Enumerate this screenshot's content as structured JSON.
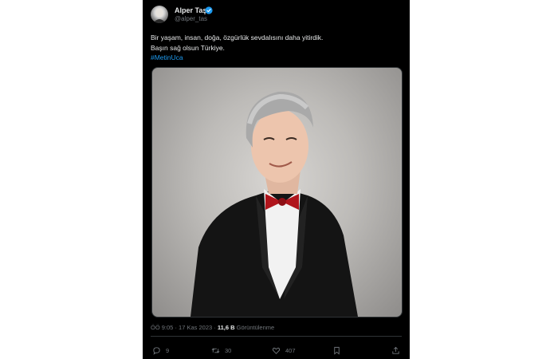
{
  "tweet": {
    "author": {
      "display_name": "Alper Taş",
      "handle": "@alper_tas",
      "verified": true
    },
    "text_lines": [
      "Bir yaşam, insan, doğa, özgürlük sevdalısını daha yitirdik.",
      "Başın sağ olsun Türkiye."
    ],
    "hashtag": "#MetinUca",
    "time": "ÖÖ 9:05",
    "date": "17 Kas 2023",
    "separator": "·",
    "views_count": "11,6 B",
    "views_label": "Görüntülenme",
    "actions": {
      "reply_count": "9",
      "retweet_count": "30",
      "like_count": "407"
    }
  },
  "colors": {
    "background": "#000000",
    "text": "#e7e9ea",
    "secondary_text": "#71767b",
    "link": "#1d9bf0",
    "verified_badge": "#1d9bf0"
  },
  "icons": [
    "verified-badge-icon",
    "reply-icon",
    "retweet-icon",
    "like-icon",
    "bookmark-icon",
    "share-icon"
  ]
}
